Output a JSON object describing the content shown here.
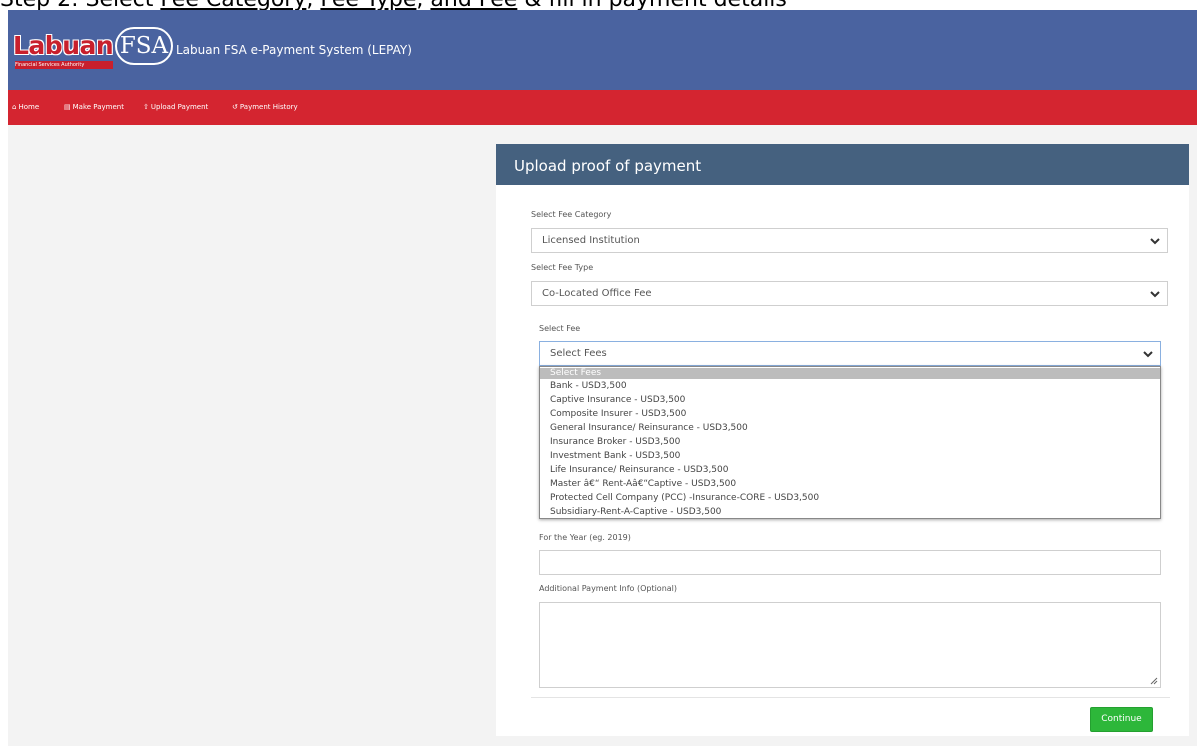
{
  "caption": {
    "prefix": "Step 2: Select ",
    "link1": "Fee Category",
    "sep1": ", ",
    "link2": "Fee Type",
    "sep2": ", ",
    "link3": "and Fee",
    "suffix": " & fill in payment details"
  },
  "header": {
    "logo_word": "Labuan",
    "logo_badge": "FSA",
    "logo_sub": "Financial Services Authority",
    "app_title": "Labuan FSA e-Payment System (LEPAY)",
    "brand_color": "#4a63a0"
  },
  "nav": {
    "color": "#d42530",
    "items": [
      {
        "label": "Home",
        "icon": "home-icon"
      },
      {
        "label": "Make Payment",
        "icon": "card-icon"
      },
      {
        "label": "Upload Payment",
        "icon": "upload-icon"
      },
      {
        "label": "Payment History",
        "icon": "history-icon"
      }
    ]
  },
  "form": {
    "title": "Upload proof of payment",
    "fee_category": {
      "label": "Select Fee Category",
      "value": "Licensed Institution"
    },
    "fee_type": {
      "label": "Select Fee Type",
      "value": "Co-Located Office Fee"
    },
    "fee": {
      "label": "Select Fee",
      "value": "Select Fees",
      "options": [
        "Select Fees",
        "Bank - USD3,500",
        "Captive Insurance - USD3,500",
        "Composite Insurer - USD3,500",
        "General Insurance/ Reinsurance - USD3,500",
        "Insurance Broker - USD3,500",
        "Investment Bank - USD3,500",
        "Life Insurance/ Reinsurance - USD3,500",
        "Master â€“ Rent-Aâ€“Captive - USD3,500",
        "Protected Cell Company (PCC) -Insurance-CORE - USD3,500",
        "Subsidiary-Rent-A-Captive - USD3,500"
      ]
    },
    "year": {
      "label": "For the Year (eg. 2019)",
      "value": ""
    },
    "additional": {
      "label": "Additional Payment Info (Optional)",
      "value": ""
    },
    "continue_label": "Continue"
  }
}
